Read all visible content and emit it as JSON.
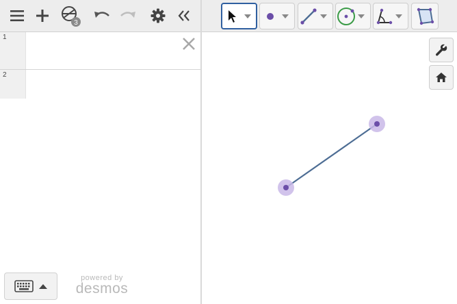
{
  "expressions": [
    {
      "index": "1",
      "value": ""
    },
    {
      "index": "2",
      "value": ""
    }
  ],
  "left_toolbar": {
    "folder_count": "3"
  },
  "branding": {
    "powered_by": "powered by",
    "brand": "desmos"
  },
  "geometry_tools": [
    {
      "name": "select-tool-icon",
      "active": true
    },
    {
      "name": "point-tool-icon",
      "active": false
    },
    {
      "name": "segment-tool-icon",
      "active": false
    },
    {
      "name": "circle-tool-icon",
      "active": false
    },
    {
      "name": "angle-tool-icon",
      "active": false
    },
    {
      "name": "polygon-tool-icon",
      "active": false
    }
  ],
  "colors": {
    "accent_blue": "#2f5fa0",
    "point_purple": "#6b4ea8",
    "point_halo": "#c9b8e8",
    "segment": "#4d6d94",
    "circle_green": "#3a9b46"
  },
  "side_buttons": [
    "wrench-icon",
    "home-icon"
  ]
}
